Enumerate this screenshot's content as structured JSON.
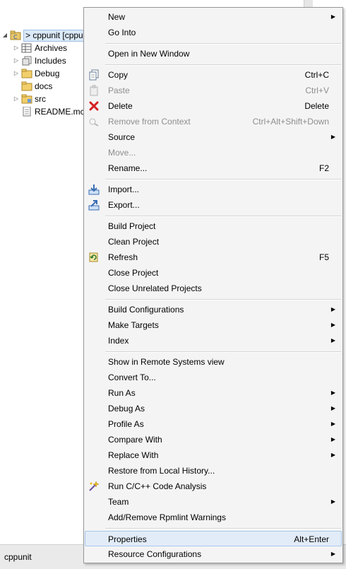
{
  "tree": {
    "root_label": "> cppunit [cppu",
    "items": [
      {
        "label": "Archives"
      },
      {
        "label": "Includes"
      },
      {
        "label": "Debug"
      },
      {
        "label": "docs"
      },
      {
        "label": "src"
      },
      {
        "label": "README.mc"
      }
    ]
  },
  "status": {
    "text": "cppunit"
  },
  "menu": {
    "new": "New",
    "go_into": "Go Into",
    "open_new_window": "Open in New Window",
    "copy": "Copy",
    "copy_sc": "Ctrl+C",
    "paste": "Paste",
    "paste_sc": "Ctrl+V",
    "delete": "Delete",
    "delete_sc": "Delete",
    "remove_context": "Remove from Context",
    "remove_context_sc": "Ctrl+Alt+Shift+Down",
    "source": "Source",
    "move": "Move...",
    "rename": "Rename...",
    "rename_sc": "F2",
    "import": "Import...",
    "export": "Export...",
    "build_project": "Build Project",
    "clean_project": "Clean Project",
    "refresh": "Refresh",
    "refresh_sc": "F5",
    "close_project": "Close Project",
    "close_unrelated": "Close Unrelated Projects",
    "build_configs": "Build Configurations",
    "make_targets": "Make Targets",
    "index": "Index",
    "show_remote": "Show in Remote Systems view",
    "convert_to": "Convert To...",
    "run_as": "Run As",
    "debug_as": "Debug As",
    "profile_as": "Profile As",
    "compare_with": "Compare With",
    "replace_with": "Replace With",
    "restore_history": "Restore from Local History...",
    "code_analysis": "Run C/C++ Code Analysis",
    "team": "Team",
    "rpmlint": "Add/Remove Rpmlint Warnings",
    "properties": "Properties",
    "properties_sc": "Alt+Enter",
    "resource_configs": "Resource Configurations"
  }
}
